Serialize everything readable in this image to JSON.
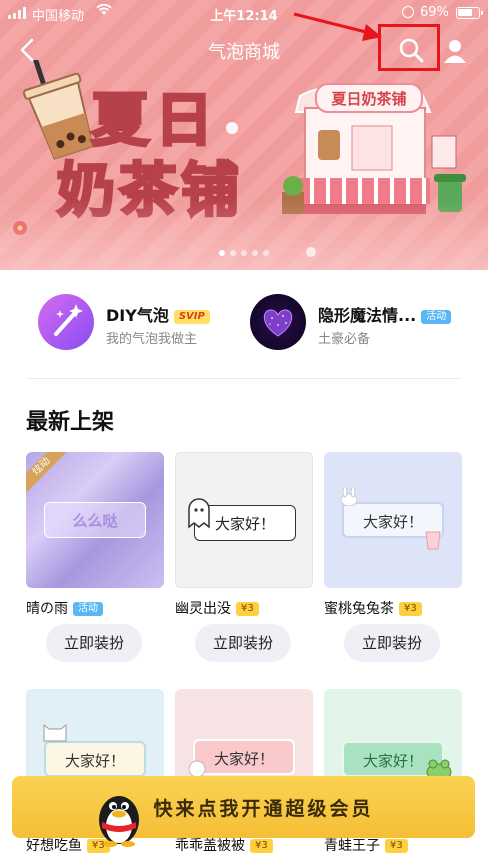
{
  "status_bar": {
    "carrier": "中国移动",
    "time": "上午12:14",
    "battery": "69%"
  },
  "nav": {
    "title": "气泡商城"
  },
  "banner": {
    "title_line1": "夏日",
    "title_line2": "奶茶铺",
    "shop_sign": "夏日奶茶铺",
    "page_count": 5,
    "active_page": 0
  },
  "features": [
    {
      "title": "DIY气泡",
      "tag": "SVIP",
      "subtitle": "我的气泡我做主"
    },
    {
      "title": "隐形魔法情...",
      "tag": "活动",
      "subtitle": "土豪必备"
    }
  ],
  "section": {
    "title": "最新上架"
  },
  "cards": [
    {
      "name": "晴の雨",
      "tag": "活动",
      "bubble_text": "么么哒",
      "corner_badge": "炫动",
      "button": "立即装扮"
    },
    {
      "name": "幽灵出没",
      "tag": "¥3",
      "bubble_text": "大家好！",
      "button": "立即装扮"
    },
    {
      "name": "蜜桃兔兔茶",
      "tag": "¥3",
      "bubble_text": "大家好！",
      "button": "立即装扮"
    },
    {
      "name": "好想吃鱼",
      "tag": "¥3",
      "bubble_text": "大家好！"
    },
    {
      "name": "乖乖盖被被",
      "tag": "¥3",
      "bubble_text": "大家好！"
    },
    {
      "name": "青蛙王子",
      "tag": "¥3",
      "bubble_text": "大家好！"
    }
  ],
  "promo": {
    "text": "快来点我开通超级会员"
  },
  "colors": {
    "banner_pink": "#f4a6a6",
    "annotation_red": "#e8141b",
    "promo_yellow": "#f4bf36",
    "event_tag_blue": "#59b7f5"
  }
}
